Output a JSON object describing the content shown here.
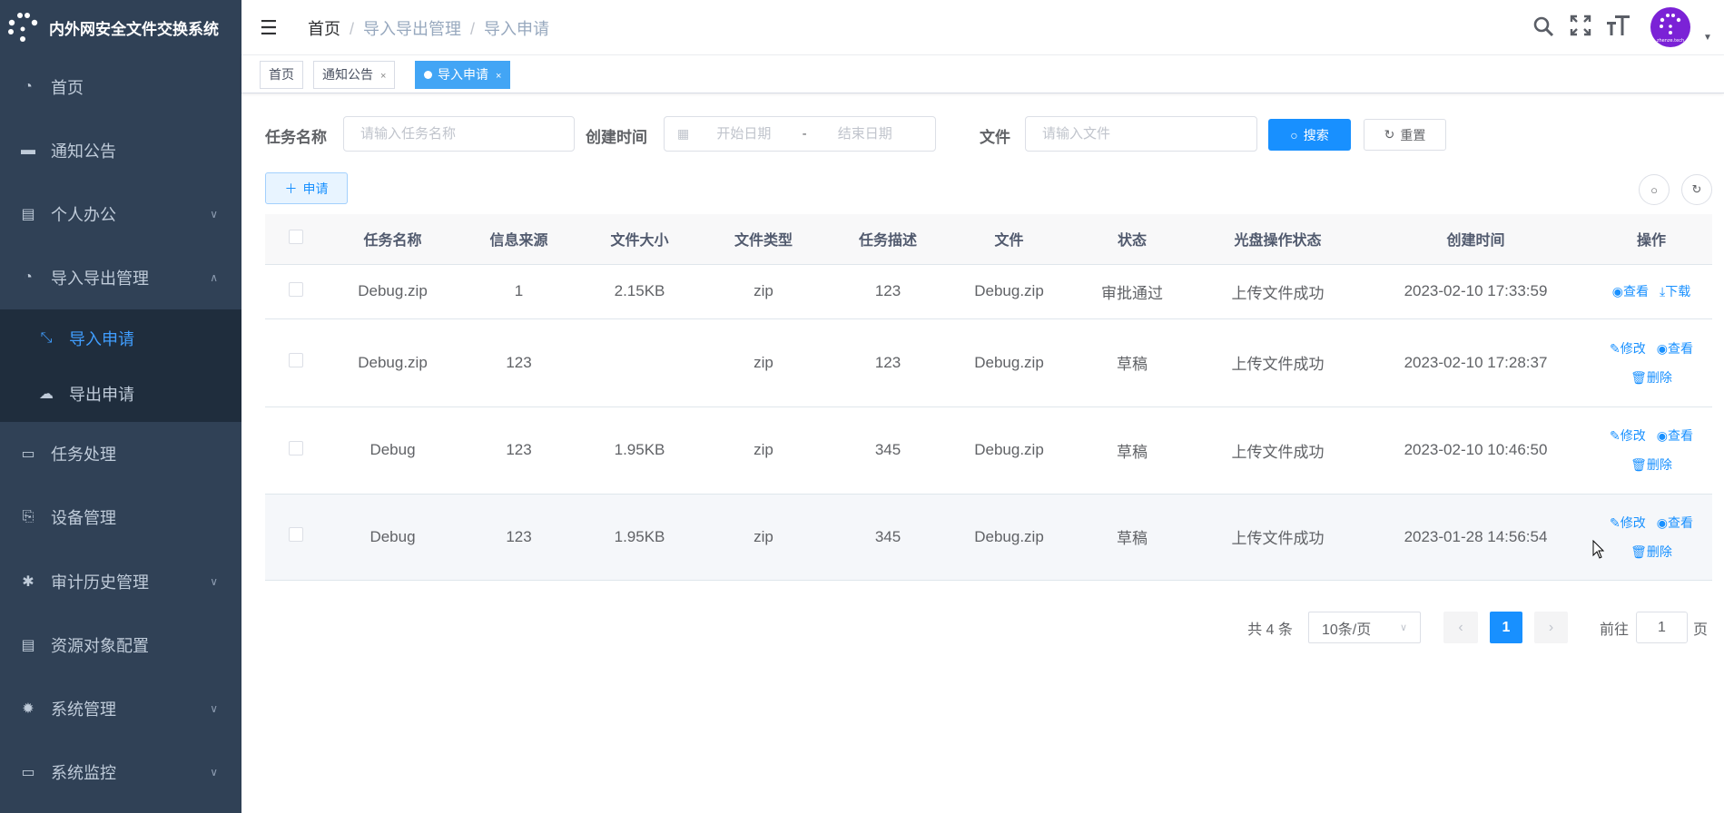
{
  "app": {
    "title": "内外网安全文件交换系统",
    "avatar_text": "zhenze.tech"
  },
  "sidebar": {
    "items": [
      {
        "label": "首页",
        "icon": "dashboard-icon"
      },
      {
        "label": "通知公告",
        "icon": "message-icon"
      },
      {
        "label": "个人办公",
        "icon": "edit-doc-icon",
        "arrow": "down"
      },
      {
        "label": "导入导出管理",
        "icon": "dashboard-icon",
        "arrow": "up"
      },
      {
        "label": "导入申请",
        "icon": "compress-icon",
        "active": true
      },
      {
        "label": "导出申请",
        "icon": "cloud-upload-icon"
      },
      {
        "label": "任务处理",
        "icon": "monitor-icon"
      },
      {
        "label": "设备管理",
        "icon": "device-icon"
      },
      {
        "label": "审计历史管理",
        "icon": "bug-icon",
        "arrow": "down"
      },
      {
        "label": "资源对象配置",
        "icon": "server-icon"
      },
      {
        "label": "系统管理",
        "icon": "gear-icon",
        "arrow": "down"
      },
      {
        "label": "系统监控",
        "icon": "monitor-icon",
        "arrow": "down"
      }
    ]
  },
  "breadcrumb": [
    "首页",
    "导入导出管理",
    "导入申请"
  ],
  "tags": [
    {
      "label": "首页"
    },
    {
      "label": "通知公告",
      "close": "×"
    },
    {
      "label": "导入申请",
      "close": "×",
      "active": true
    }
  ],
  "search": {
    "task_label": "任务名称",
    "task_placeholder": "请输入任务名称",
    "time_label": "创建时间",
    "start_placeholder": "开始日期",
    "range_sep": "-",
    "end_placeholder": "结束日期",
    "file_label": "文件",
    "file_placeholder": "请输入文件",
    "search_btn": "搜索",
    "reset_btn": "重置"
  },
  "toolbar": {
    "add_btn": "申请"
  },
  "table": {
    "columns": [
      "任务名称",
      "信息来源",
      "文件大小",
      "文件类型",
      "任务描述",
      "文件",
      "状态",
      "光盘操作状态",
      "创建时间",
      "操作"
    ],
    "rows": [
      [
        "Debug.zip",
        "1",
        "2.15KB",
        "zip",
        "123",
        "Debug.zip",
        "审批通过",
        "上传文件成功",
        "2023-02-10 17:33:59"
      ],
      [
        "Debug.zip",
        "123",
        "",
        "zip",
        "123",
        "Debug.zip",
        "草稿",
        "上传文件成功",
        "2023-02-10 17:28:37"
      ],
      [
        "Debug",
        "123",
        "1.95KB",
        "zip",
        "345",
        "Debug.zip",
        "草稿",
        "上传文件成功",
        "2023-02-10 10:46:50"
      ],
      [
        "Debug",
        "123",
        "1.95KB",
        "zip",
        "345",
        "Debug.zip",
        "草稿",
        "上传文件成功",
        "2023-01-28 14:56:54"
      ]
    ],
    "actions": [
      [
        "查看",
        "下载"
      ],
      [
        "修改",
        "查看",
        "删除"
      ],
      [
        "修改",
        "查看",
        "删除"
      ],
      [
        "修改",
        "查看",
        "删除"
      ]
    ]
  },
  "pagination": {
    "total": "共 4 条",
    "page_size": "10条/页",
    "current": "1",
    "goto_label": "前往",
    "goto_value": "1",
    "page_suffix": "页"
  },
  "colors": {
    "sidebar": "#304156",
    "primary": "#1890ff",
    "tag_active": "#42a5f5",
    "avatar": "#7b22d6"
  }
}
